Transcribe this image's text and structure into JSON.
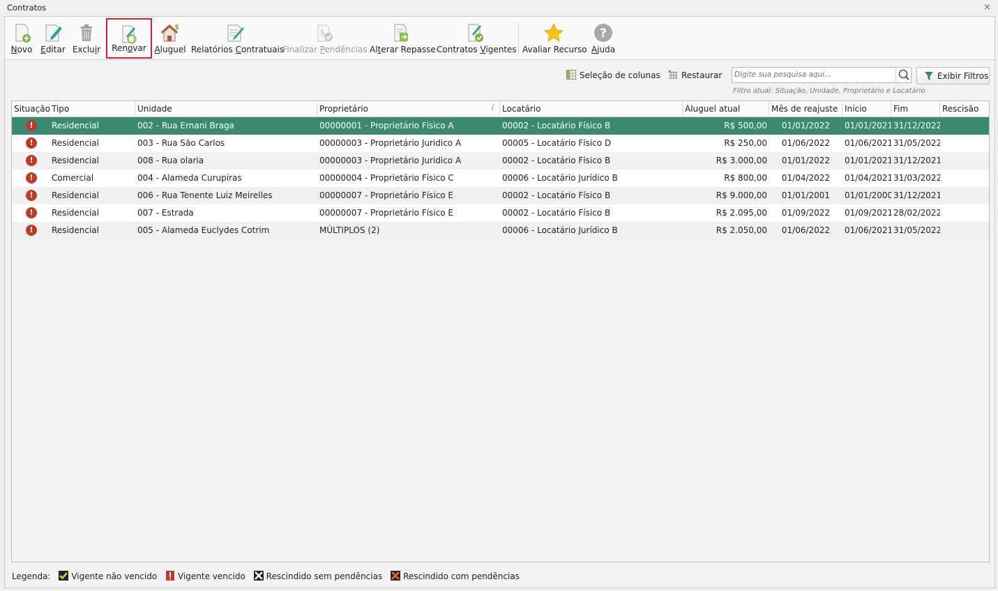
{
  "window": {
    "title": "Contratos",
    "close_symbol": "×"
  },
  "toolbar": {
    "buttons": [
      {
        "label": "Novo",
        "accel": "N",
        "rest": "ovo",
        "pre": "",
        "icon": "new-document-icon",
        "disabled": false
      },
      {
        "label": "Editar",
        "accel": "E",
        "rest": "ditar",
        "pre": "",
        "icon": "edit-pencil-icon",
        "disabled": false
      },
      {
        "label": "Excluir",
        "accel": "i",
        "rest": "r",
        "pre": "Exclu",
        "icon": "trash-icon",
        "disabled": false
      },
      {
        "label": "Renovar",
        "accel": "o",
        "rest": "var",
        "pre": "Ren",
        "icon": "renew-icon",
        "disabled": false
      },
      {
        "label": "Aluguel",
        "accel": "A",
        "rest": "luguel",
        "pre": "",
        "icon": "house-money-icon",
        "disabled": false
      },
      {
        "label": "Relatórios Contratuais",
        "accel": "C",
        "rest": "ontratuais",
        "pre": "Relatórios ",
        "icon": "report-icon",
        "disabled": false
      },
      {
        "label": "Finalizar Pendências",
        "accel": "P",
        "rest": "endências",
        "pre": "Finalizar ",
        "icon": "finalize-pending-icon",
        "disabled": true
      },
      {
        "label": "Alterar Repasse",
        "accel": "t",
        "rest": "erar Repasse",
        "pre": "Al",
        "icon": "transfer-icon",
        "disabled": false
      },
      {
        "label": "Contratos Vigentes",
        "accel": "V",
        "rest": "igentes",
        "pre": "Contratos ",
        "icon": "active-contracts-icon",
        "disabled": false
      },
      {
        "label": "Avaliar Recurso",
        "accel": "",
        "rest": "Avaliar Recurso",
        "pre": "",
        "icon": "star-icon",
        "disabled": false
      },
      {
        "label": "Ajuda",
        "accel": "A",
        "rest": "juda",
        "pre": "",
        "icon": "help-icon",
        "disabled": false
      }
    ]
  },
  "search": {
    "columns_label": "Seleção de colunas",
    "restore_label": "Restaurar",
    "placeholder": "Digite sua pesquisa aqui...",
    "filter_note": "Filtro atual: Situação, Unidade, Proprietário e Locatário",
    "filters_label": "Exibir Filtros"
  },
  "grid": {
    "columns": [
      "Situação",
      "Tipo",
      "Unidade",
      "Proprietário",
      "Locatário",
      "Aluguel atual",
      "Mês de reajuste",
      "Início",
      "Fim",
      "Rescisão"
    ],
    "sort_indicator": "/",
    "rows": [
      {
        "status": "!",
        "tipo": "Residencial",
        "unidade": "002 - Rua Ernani Braga",
        "proprietario": "00000001 - Proprietário Físico A",
        "locatario": "00002 - Locatário Físico B",
        "aluguel": "R$ 500,00",
        "reajuste": "01/01/2022",
        "inicio": "01/01/2021",
        "fim": "31/12/2022",
        "rescisao": ""
      },
      {
        "status": "!",
        "tipo": "Residencial",
        "unidade": "003 - Rua São Carlos",
        "proprietario": "00000003 - Proprietário Juridico A",
        "locatario": "00005 - Locatário Físico D",
        "aluguel": "R$ 250,00",
        "reajuste": "01/06/2022",
        "inicio": "01/06/2021",
        "fim": "31/05/2022",
        "rescisao": ""
      },
      {
        "status": "!",
        "tipo": "Residencial",
        "unidade": "008 - Rua olaria",
        "proprietario": "00000003 - Proprietário Juridico A",
        "locatario": "00002 - Locatário Físico B",
        "aluguel": "R$ 3.000,00",
        "reajuste": "01/01/2022",
        "inicio": "01/01/2021",
        "fim": "31/12/2021",
        "rescisao": ""
      },
      {
        "status": "!",
        "tipo": "Comercial",
        "unidade": "004 - Alameda Curupiras",
        "proprietario": "00000004 - Proprietário Físico C",
        "locatario": "00006 - Locatário Jurídico B",
        "aluguel": "R$ 800,00",
        "reajuste": "01/04/2022",
        "inicio": "01/04/2021",
        "fim": "31/03/2022",
        "rescisao": ""
      },
      {
        "status": "!",
        "tipo": "Residencial",
        "unidade": "006 - Rua Tenente Luiz Meirelles",
        "proprietario": "00000007 - Proprietário Físico E",
        "locatario": "00002 - Locatário Físico B",
        "aluguel": "R$ 9.000,00",
        "reajuste": "01/01/2001",
        "inicio": "01/01/2000",
        "fim": "31/12/2021",
        "rescisao": ""
      },
      {
        "status": "!",
        "tipo": "Residencial",
        "unidade": "007 - Estrada",
        "proprietario": "00000007 - Proprietário Físico E",
        "locatario": "00002 - Locatário Físico B",
        "aluguel": "R$ 2.095,00",
        "reajuste": "01/09/2022",
        "inicio": "01/09/2021",
        "fim": "28/02/2022",
        "rescisao": ""
      },
      {
        "status": "!",
        "tipo": "Residencial",
        "unidade": "005 - Alameda Euclydes Cotrim",
        "proprietario": "MÚLTIPLOS (2)",
        "locatario": "00006 - Locatário Jurídico B",
        "aluguel": "R$ 2.050,00",
        "reajuste": "01/06/2022",
        "inicio": "01/06/2021",
        "fim": "31/05/2022",
        "rescisao": ""
      }
    ]
  },
  "legend": {
    "title": "Legenda:",
    "items": [
      {
        "label": "Vigente não vencido",
        "icon": "check-green-icon",
        "color": "#8bc34a"
      },
      {
        "label": "Vigente vencido",
        "icon": "exclamation-red-icon",
        "color": "#c0392b"
      },
      {
        "label": "Rescindido sem pendências",
        "icon": "x-black-icon",
        "color": "#222222"
      },
      {
        "label": "Rescindido com pendências",
        "icon": "x-orange-icon",
        "color": "#e0622a"
      }
    ]
  },
  "colors": {
    "selected_row": "#3a8a72",
    "status_red": "#c0392b",
    "highlight_border": "#d8202a",
    "accent_green": "#2e8b57"
  }
}
